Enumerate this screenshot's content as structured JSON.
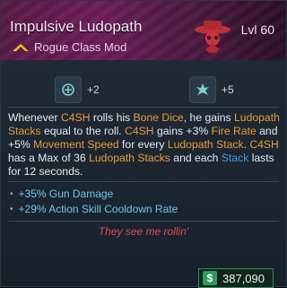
{
  "item": {
    "name": "Impulsive Ludopath",
    "type": "Rogue Class Mod",
    "level": "Lvl 60"
  },
  "stats": [
    {
      "icon": "grenade-icon",
      "value": "+2"
    },
    {
      "icon": "splash-icon",
      "value": "+5"
    }
  ],
  "description_parts": {
    "p1": "Whenever ",
    "c4sh1": "C4SH",
    "p2": " rolls his ",
    "bone": "Bone Dice",
    "p3": ", he gains ",
    "lud1": "Ludopath Stacks",
    "p4": " equal to the roll. ",
    "c4sh2": "C4SH",
    "p5": " gains +3% ",
    "fire": "Fire Rate",
    "p6": " and +5% ",
    "move": "Movement Speed",
    "p7": " for every ",
    "lud2": "Ludopath Stack",
    "p8": ". ",
    "c4sh3": "C4SH",
    "p9": " has a Max of 36 ",
    "lud3": "Ludopath Stacks",
    "p10": " and each ",
    "stack": "Stack",
    "p11": " lasts for 12 seconds."
  },
  "bullets": [
    "+35% Gun Damage",
    "+29% Action Skill Cooldown Rate"
  ],
  "flavor": "They see me rollin'",
  "price": {
    "symbol": "$",
    "amount": "387,090"
  },
  "colors": {
    "highlight": "#e89a3b",
    "stat_blue": "#6ec3f0",
    "flavor_red": "#e0485a",
    "header": "#6b1d58"
  }
}
